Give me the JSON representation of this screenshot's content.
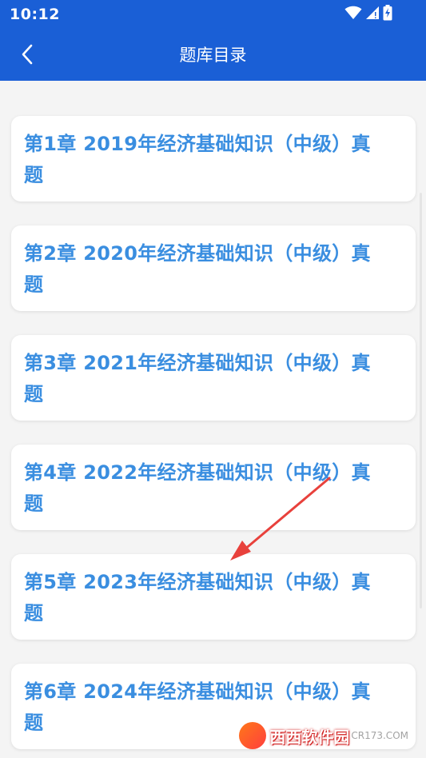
{
  "status_bar": {
    "time": "10:12",
    "icons": [
      "wifi-icon",
      "signal-icon",
      "battery-charging-icon"
    ]
  },
  "header": {
    "title": "题库目录",
    "back_icon": "chevron-left-icon"
  },
  "chapters": [
    {
      "title": "第1章 2019年经济基础知识（中级）真题"
    },
    {
      "title": "第2章 2020年经济基础知识（中级）真题"
    },
    {
      "title": "第3章 2021年经济基础知识（中级）真题"
    },
    {
      "title": "第4章 2022年经济基础知识（中级）真题"
    },
    {
      "title": "第5章 2023年经济基础知识（中级）真题"
    },
    {
      "title": "第6章 2024年经济基础知识（中级）真题"
    }
  ],
  "watermark": {
    "brand": "西西软件园",
    "site": "CR173.COM"
  },
  "colors": {
    "header_bg": "#1a5fd6",
    "card_text": "#3a8ee0",
    "page_bg": "#f4f4f4",
    "annotation_arrow": "#e8413c"
  }
}
